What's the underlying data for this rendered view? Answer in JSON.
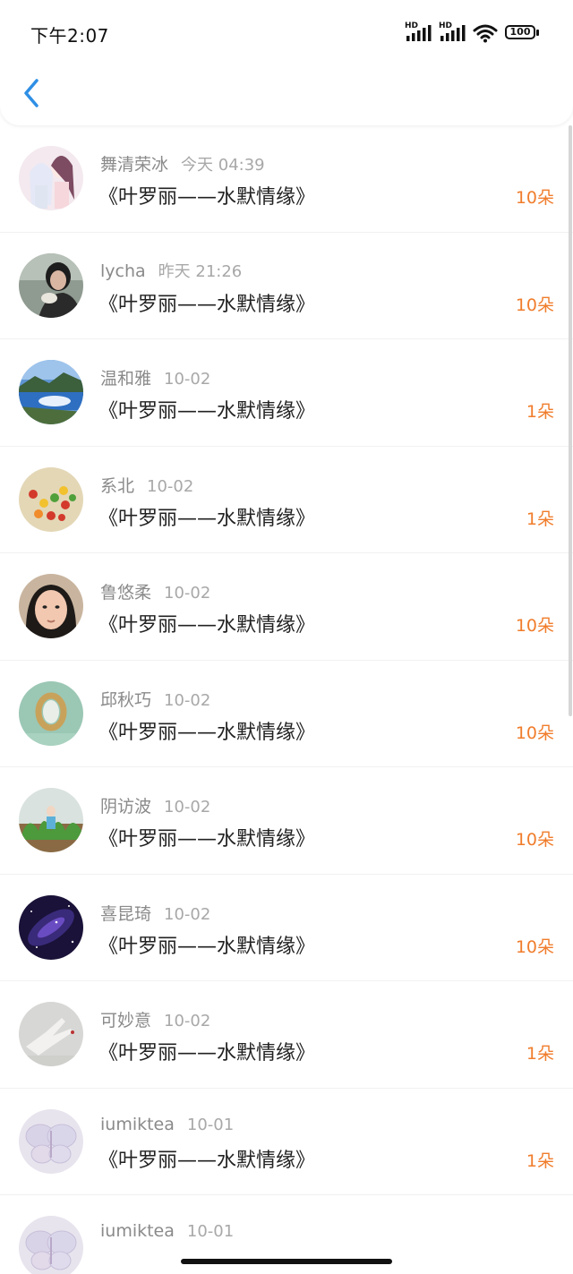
{
  "status_bar": {
    "time": "下午2:07",
    "hd1": "HD",
    "hd2": "HD",
    "battery": "100",
    "icons": [
      "hd-signal-icon",
      "hd-signal-icon",
      "wifi-icon",
      "battery-icon"
    ]
  },
  "nav": {
    "back_icon": "chevron-left-icon"
  },
  "colors": {
    "amount": "#f07d2c",
    "back": "#2f8fe5",
    "name": "#8a8a8a",
    "title": "#222222"
  },
  "gifts": [
    {
      "name": "舞清荣冰",
      "time": "今天 04:39",
      "title": "《叶罗丽——水默情缘》",
      "amount": "10朵",
      "avatar": "anime-girls"
    },
    {
      "name": "lycha",
      "time": "昨天 21:26",
      "title": "《叶罗丽——水默情缘》",
      "amount": "10朵",
      "avatar": "girl-photo"
    },
    {
      "name": "温和雅",
      "time": "10-02",
      "title": "《叶罗丽——水默情缘》",
      "amount": "1朵",
      "avatar": "lake-landscape"
    },
    {
      "name": "系北",
      "time": "10-02",
      "title": "《叶罗丽——水默情缘》",
      "amount": "1朵",
      "avatar": "candies"
    },
    {
      "name": "鲁悠柔",
      "time": "10-02",
      "title": "《叶罗丽——水默情缘》",
      "amount": "10朵",
      "avatar": "child-face"
    },
    {
      "name": "邱秋巧",
      "time": "10-02",
      "title": "《叶罗丽——水默情缘》",
      "amount": "10朵",
      "avatar": "mirror-frame"
    },
    {
      "name": "阴访波",
      "time": "10-02",
      "title": "《叶罗丽——水默情缘》",
      "amount": "10朵",
      "avatar": "figurine-plants"
    },
    {
      "name": "喜昆琦",
      "time": "10-02",
      "title": "《叶罗丽——水默情缘》",
      "amount": "10朵",
      "avatar": "galaxy"
    },
    {
      "name": "可妙意",
      "time": "10-02",
      "title": "《叶罗丽——水默情缘》",
      "amount": "1朵",
      "avatar": "hand-gesture"
    },
    {
      "name": "iumiktea",
      "time": "10-01",
      "title": "《叶罗丽——水默情缘》",
      "amount": "1朵",
      "avatar": "butterfly"
    },
    {
      "name": "iumiktea",
      "time": "10-01",
      "title": "",
      "amount": "",
      "avatar": "butterfly"
    }
  ]
}
